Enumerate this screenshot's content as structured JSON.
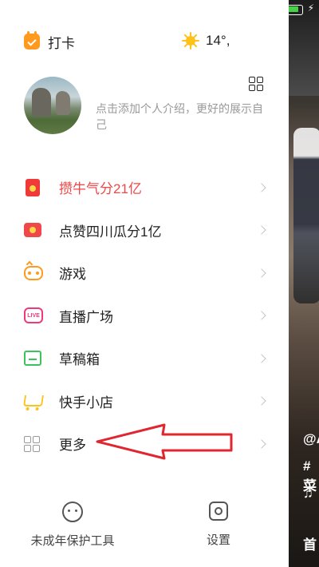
{
  "header": {
    "checkin_label": "打卡",
    "weather_temp": "14°,",
    "icons": [
      "calendar-check-icon",
      "sun-icon",
      "qr-code-icon"
    ]
  },
  "profile": {
    "bio_placeholder": "点击添加个人介绍，更好的展示自己"
  },
  "menu": {
    "items": [
      {
        "label": "攒牛气分21亿",
        "icon": "red-packet-icon",
        "highlight": true
      },
      {
        "label": "点赞四川瓜分1亿",
        "icon": "red-envelope-icon",
        "highlight": false
      },
      {
        "label": "游戏",
        "icon": "gamepad-icon",
        "highlight": false
      },
      {
        "label": "直播广场",
        "icon": "live-icon",
        "highlight": false
      },
      {
        "label": "草稿箱",
        "icon": "folder-icon",
        "highlight": false
      },
      {
        "label": "快手小店",
        "icon": "cart-icon",
        "highlight": false
      },
      {
        "label": "更多",
        "icon": "grid-icon",
        "highlight": false
      }
    ]
  },
  "bottom": {
    "minor_protection_label": "未成年保护工具",
    "settings_label": "设置"
  },
  "video_overlay": {
    "line1": "@A",
    "line2": "#菜",
    "line3": "首"
  },
  "colors": {
    "highlight_red": "#f04848",
    "annotation_arrow": "#e0262f",
    "checkin_orange": "#ff9a1f"
  }
}
